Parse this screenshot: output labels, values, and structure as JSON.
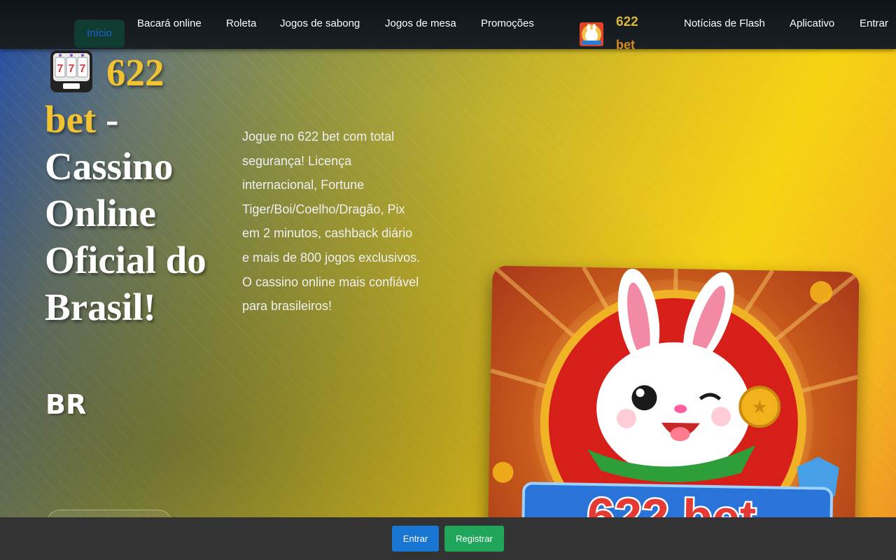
{
  "nav": {
    "items": [
      {
        "label": "Início",
        "active": true
      },
      {
        "label": "Bacará online"
      },
      {
        "label": "Roleta"
      },
      {
        "label": "Jogos de sabong"
      },
      {
        "label": "Jogos de mesa"
      },
      {
        "label": "Promoções"
      },
      {
        "label": "Notícias de Flash"
      },
      {
        "label": "Aplicativo"
      },
      {
        "label": "Entrar"
      }
    ],
    "brand": {
      "number": "622",
      "name": "bet"
    }
  },
  "hero": {
    "title_brand_num": "622",
    "title_brand_bet": "bet",
    "title_rest": " - Cassino Online Oficial do Brasil!",
    "subtitle": "BR",
    "description": "Jogue no 622 bet com total segurança! Licença internacional, Fortune Tiger/Boi/Coelho/Dragão, Pix em 2 minutos, cashback diário e mais de 800 jogos exclusivos. O cassino online mais confiável para brasileiros!"
  },
  "promo": {
    "logo_text": "622 bet"
  },
  "bottom": {
    "login_label": "Entrar",
    "register_label": "Registrar"
  },
  "colors": {
    "nav_bg": "#13191d",
    "accent_gold": "#f1c232",
    "login_blue": "#1976d2",
    "register_green": "#1fa65a"
  }
}
